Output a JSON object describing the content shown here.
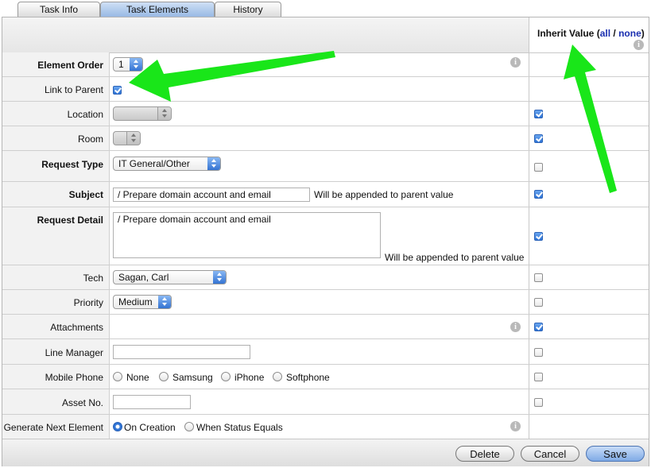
{
  "tabs": [
    {
      "label": "Task Info",
      "active": false
    },
    {
      "label": "Task Elements",
      "active": true
    },
    {
      "label": "History",
      "active": false
    }
  ],
  "inherit_header": {
    "title": "Inherit Value",
    "open_paren": "(",
    "all_link": "all",
    "separator": "/",
    "none_link": "none",
    "close_paren": ")"
  },
  "rows": {
    "element_order": {
      "label": "Element Order",
      "value": "1"
    },
    "link_to_parent": {
      "label": "Link to Parent",
      "checked": true
    },
    "location": {
      "label": "Location",
      "value": "",
      "inherit": true
    },
    "room": {
      "label": "Room",
      "value": "",
      "inherit": true
    },
    "request_type": {
      "label": "Request Type",
      "value": "IT General/Other",
      "inherit": false
    },
    "subject": {
      "label": "Subject",
      "value": "/ Prepare domain account and email",
      "note": "Will be appended to parent value",
      "inherit": true
    },
    "request_detail": {
      "label": "Request Detail",
      "value": "/ Prepare domain account and email",
      "note": "Will be appended to parent value",
      "inherit": true
    },
    "tech": {
      "label": "Tech",
      "value": "Sagan, Carl",
      "inherit": false
    },
    "priority": {
      "label": "Priority",
      "value": "Medium",
      "inherit": false
    },
    "attachments": {
      "label": "Attachments",
      "inherit": true
    },
    "line_manager": {
      "label": "Line Manager",
      "value": "",
      "inherit": false
    },
    "mobile_phone": {
      "label": "Mobile Phone",
      "options": [
        "None",
        "Samsung",
        "iPhone",
        "Softphone"
      ],
      "inherit": false
    },
    "asset_no": {
      "label": "Asset No.",
      "value": "",
      "inherit": false
    },
    "generate_next": {
      "label": "Generate Next Element",
      "options": [
        "On Creation",
        "When Status Equals"
      ],
      "selected": "On Creation"
    }
  },
  "info_glyph": "i",
  "buttons": {
    "delete": "Delete",
    "cancel": "Cancel",
    "save": "Save"
  },
  "colors": {
    "arrow": "#19e619",
    "accent": "#2f74d6",
    "link": "#1a2fb0"
  }
}
